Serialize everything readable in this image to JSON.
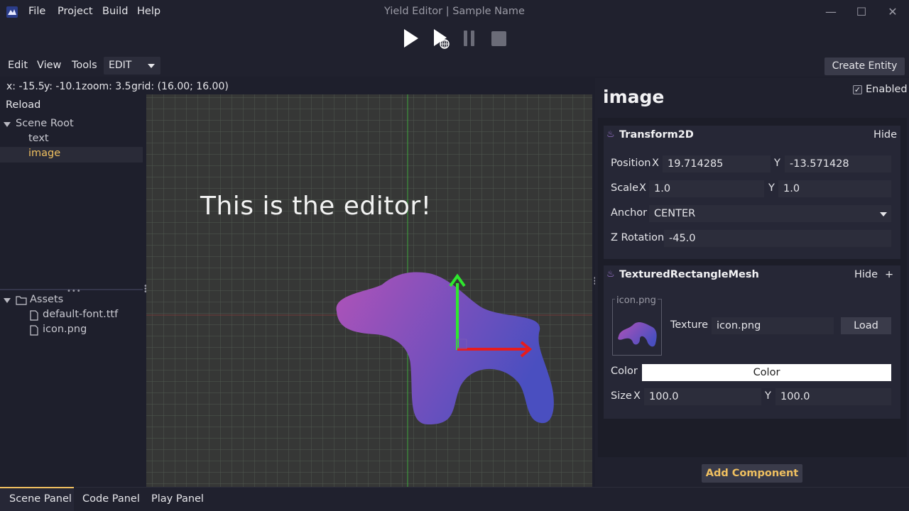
{
  "app": {
    "title": "Yield Editor | Sample Name",
    "menus": [
      "File",
      "Project",
      "Build",
      "Help"
    ]
  },
  "window_controls": {
    "minimize": "—",
    "maximize": "☐",
    "close": "✕"
  },
  "toolbar": {
    "menus": [
      "Edit",
      "View",
      "Tools"
    ],
    "mode": "EDIT",
    "create_entity": "Create Entity"
  },
  "status": {
    "x": "x: -15.5",
    "y": "y: -10.1",
    "zoom": "zoom: 3.5",
    "grid": "grid: (16.00; 16.00)"
  },
  "scene_tree": {
    "reload": "Reload",
    "root": "Scene Root",
    "children": [
      {
        "label": "text",
        "selected": false
      },
      {
        "label": "image",
        "selected": true
      }
    ]
  },
  "assets": {
    "root": "Assets",
    "files": [
      "default-font.ttf",
      "icon.png"
    ]
  },
  "viewport": {
    "text": "This is the editor!"
  },
  "inspector": {
    "entity_name": "image",
    "enabled_label": "Enabled",
    "enabled": true,
    "transform": {
      "title": "Transform2D",
      "hide": "Hide",
      "position_label": "Position",
      "x_label": "X",
      "y_label": "Y",
      "position_x": "19.714285",
      "position_y": "-13.571428",
      "scale_label": "Scale",
      "scale_x": "1.0",
      "scale_y": "1.0",
      "anchor_label": "Anchor",
      "anchor_value": "CENTER",
      "z_rotation_label": "Z Rotation",
      "z_rotation": "-45.0"
    },
    "mesh": {
      "title": "TexturedRectangleMesh",
      "hide": "Hide",
      "add": "+",
      "preview_label": "icon.png",
      "texture_label": "Texture",
      "texture_value": "icon.png",
      "load": "Load",
      "color_label": "Color",
      "color_button": "Color",
      "size_label": "Size",
      "x_label": "X",
      "y_label": "Y",
      "size_x": "100.0",
      "size_y": "100.0"
    },
    "add_component": "Add Component"
  },
  "bottom_tabs": [
    "Scene Panel",
    "Code Panel",
    "Play Panel"
  ],
  "colors": {
    "accent": "#f0c060",
    "selected_text": "#f0c060",
    "gizmo_x": "#e81c1c",
    "gizmo_y": "#2ee82e",
    "blob_start": "#b052b8",
    "blob_end": "#4a4fc0"
  }
}
